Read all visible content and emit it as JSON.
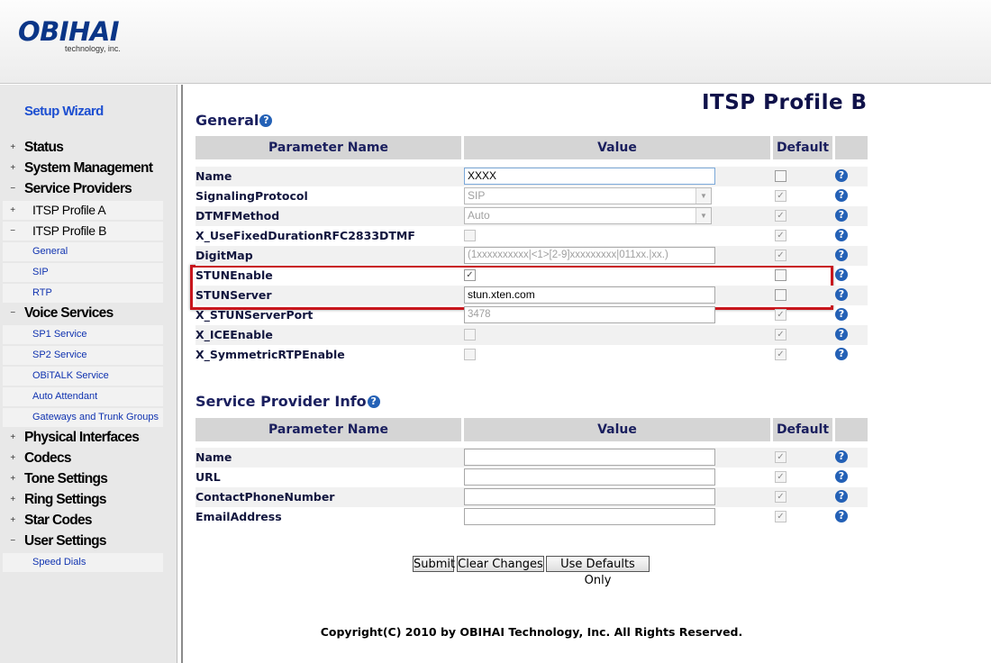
{
  "header": {
    "brand": "OBIHAI",
    "tagline": "technology, inc."
  },
  "nav": {
    "wizard": "Setup Wizard",
    "status": "Status",
    "system_management": "System Management",
    "service_providers": "Service Providers",
    "itsp_profile_a": "ITSP Profile A",
    "itsp_profile_b": "ITSP Profile B",
    "general": "General",
    "sip": "SIP",
    "rtp": "RTP",
    "voice_services": "Voice Services",
    "sp1_service": "SP1 Service",
    "sp2_service": "SP2 Service",
    "obitalk_service": "OBiTALK Service",
    "auto_attendant": "Auto Attendant",
    "gateways": "Gateways and Trunk Groups",
    "physical_interfaces": "Physical Interfaces",
    "codecs": "Codecs",
    "tone_settings": "Tone Settings",
    "ring_settings": "Ring Settings",
    "star_codes": "Star Codes",
    "user_settings": "User Settings",
    "speed_dials": "Speed Dials",
    "plus": "+",
    "minus": "−"
  },
  "page": {
    "title": "ITSP Profile B"
  },
  "general": {
    "title": "General",
    "headers": {
      "param": "Parameter Name",
      "value": "Value",
      "default": "Default"
    },
    "name": {
      "label": "Name",
      "value": "XXXX"
    },
    "signaling": {
      "label": "SignalingProtocol",
      "value": "SIP"
    },
    "dtmf": {
      "label": "DTMFMethod",
      "value": "Auto"
    },
    "fixed_duration": {
      "label": "X_UseFixedDurationRFC2833DTMF"
    },
    "digitmap": {
      "label": "DigitMap",
      "value": "(1xxxxxxxxxx|<1>[2-9]xxxxxxxxx|011xx.|xx.)"
    },
    "stun_enable": {
      "label": "STUNEnable"
    },
    "stun_server": {
      "label": "STUNServer",
      "value": "stun.xten.com"
    },
    "stun_port": {
      "label": "X_STUNServerPort",
      "value": "3478"
    },
    "ice_enable": {
      "label": "X_ICEEnable"
    },
    "symmetric_rtp": {
      "label": "X_SymmetricRTPEnable"
    }
  },
  "provider_info": {
    "title": "Service Provider Info",
    "headers": {
      "param": "Parameter Name",
      "value": "Value",
      "default": "Default"
    },
    "name": {
      "label": "Name",
      "value": ""
    },
    "url": {
      "label": "URL",
      "value": ""
    },
    "phone": {
      "label": "ContactPhoneNumber",
      "value": ""
    },
    "email": {
      "label": "EmailAddress",
      "value": ""
    }
  },
  "icons": {
    "help": "?",
    "check": "✓",
    "dropdown": "▼"
  },
  "buttons": {
    "submit": "Submit",
    "clear": "Clear Changes",
    "defaults": "Use Defaults Only"
  },
  "footer": {
    "copyright": "Copyright(C) 2010 by OBIHAI Technology, Inc. All Rights Reserved."
  },
  "colors": {
    "brand": "#0a3587",
    "highlight_box": "#c8161d",
    "section_title": "#1a1f5e",
    "nav_link": "#1033b0"
  }
}
